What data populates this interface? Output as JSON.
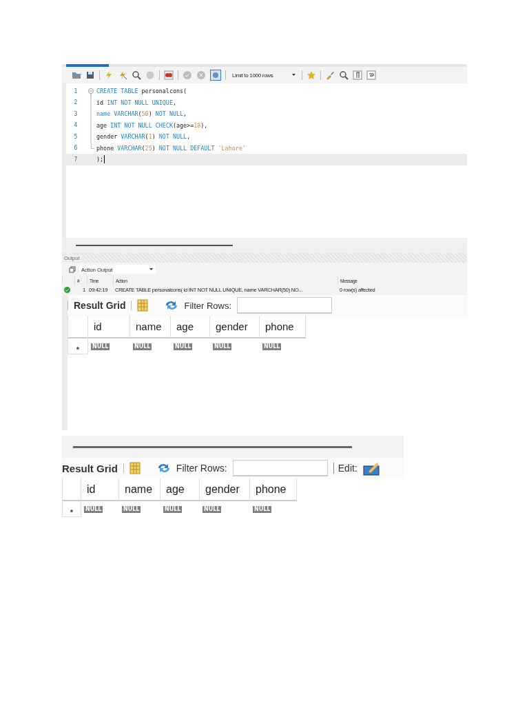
{
  "editor": {
    "toolbar": {
      "limit": "Limit to 1000 rows",
      "toggle_selected": true
    },
    "lines": [
      {
        "number": "1",
        "kind": "fold_start",
        "current": false,
        "tokens": [
          {
            "kind": "kw",
            "text": "CREATE TABLE "
          },
          {
            "kind": "plain",
            "text": "personalcons("
          }
        ]
      },
      {
        "number": "2",
        "kind": "fold_inside",
        "current": false,
        "tokens": [
          {
            "kind": "plain",
            "text": "id "
          },
          {
            "kind": "kw",
            "text": "INT NOT NULL UNIQUE"
          },
          {
            "kind": "plain",
            "text": ","
          }
        ]
      },
      {
        "number": "3",
        "kind": "fold_inside",
        "current": false,
        "tokens": [
          {
            "kind": "kw",
            "text": "name VARCHAR"
          },
          {
            "kind": "plain",
            "text": "("
          },
          {
            "kind": "num",
            "text": "50"
          },
          {
            "kind": "plain",
            "text": ") "
          },
          {
            "kind": "kw",
            "text": "NOT NULL"
          },
          {
            "kind": "plain",
            "text": ","
          }
        ]
      },
      {
        "number": "4",
        "kind": "fold_inside",
        "current": false,
        "tokens": [
          {
            "kind": "plain",
            "text": "age "
          },
          {
            "kind": "kw",
            "text": "INT NOT NULL CHECK"
          },
          {
            "kind": "plain",
            "text": "(age>="
          },
          {
            "kind": "num",
            "text": "18"
          },
          {
            "kind": "plain",
            "text": "),"
          }
        ]
      },
      {
        "number": "5",
        "kind": "fold_inside",
        "current": false,
        "tokens": [
          {
            "kind": "plain",
            "text": "gender "
          },
          {
            "kind": "kw",
            "text": "VARCHAR"
          },
          {
            "kind": "plain",
            "text": "("
          },
          {
            "kind": "num",
            "text": "1"
          },
          {
            "kind": "plain",
            "text": ") "
          },
          {
            "kind": "kw",
            "text": "NOT NULL"
          },
          {
            "kind": "plain",
            "text": ","
          }
        ]
      },
      {
        "number": "6",
        "kind": "fold_end",
        "current": false,
        "tokens": [
          {
            "kind": "plain",
            "text": "phone "
          },
          {
            "kind": "kw",
            "text": "VARCHAR"
          },
          {
            "kind": "plain",
            "text": "("
          },
          {
            "kind": "num",
            "text": "25"
          },
          {
            "kind": "plain",
            "text": ") "
          },
          {
            "kind": "kw",
            "text": "NOT NULL DEFAULT "
          },
          {
            "kind": "str",
            "text": "'Lahore'"
          }
        ]
      },
      {
        "number": "7",
        "kind": "plain",
        "current": true,
        "tokens": [
          {
            "kind": "plain",
            "text": ");"
          }
        ]
      }
    ]
  },
  "output": {
    "title": "Output",
    "selector": "Action Output",
    "columns": [
      "#",
      "Time",
      "Action",
      "Message"
    ],
    "rows": [
      {
        "kind": "success",
        "index": "1",
        "time": "09:42:19",
        "action": "CREATE TABLE personalcons( id INT NOT NULL UNIQUE, name VARCHAR(50) NO...",
        "message": "0 row(s) affected"
      }
    ]
  },
  "result_grids": [
    {
      "title": "Result Grid",
      "filter_label": "Filter Rows:",
      "columns": [
        "id",
        "name",
        "age",
        "gender",
        "phone"
      ],
      "rows": [
        {
          "marker": "*",
          "cells": [
            "NULL",
            "NULL",
            "NULL",
            "NULL",
            "NULL"
          ]
        }
      ]
    },
    {
      "title": "Result Grid",
      "filter_label": "Filter Rows:",
      "edit_label": "Edit:",
      "columns": [
        "id",
        "name",
        "age",
        "gender",
        "phone"
      ],
      "rows": [
        {
          "marker": "*",
          "cells": [
            "NULL",
            "NULL",
            "NULL",
            "NULL",
            "NULL"
          ]
        }
      ]
    }
  ]
}
